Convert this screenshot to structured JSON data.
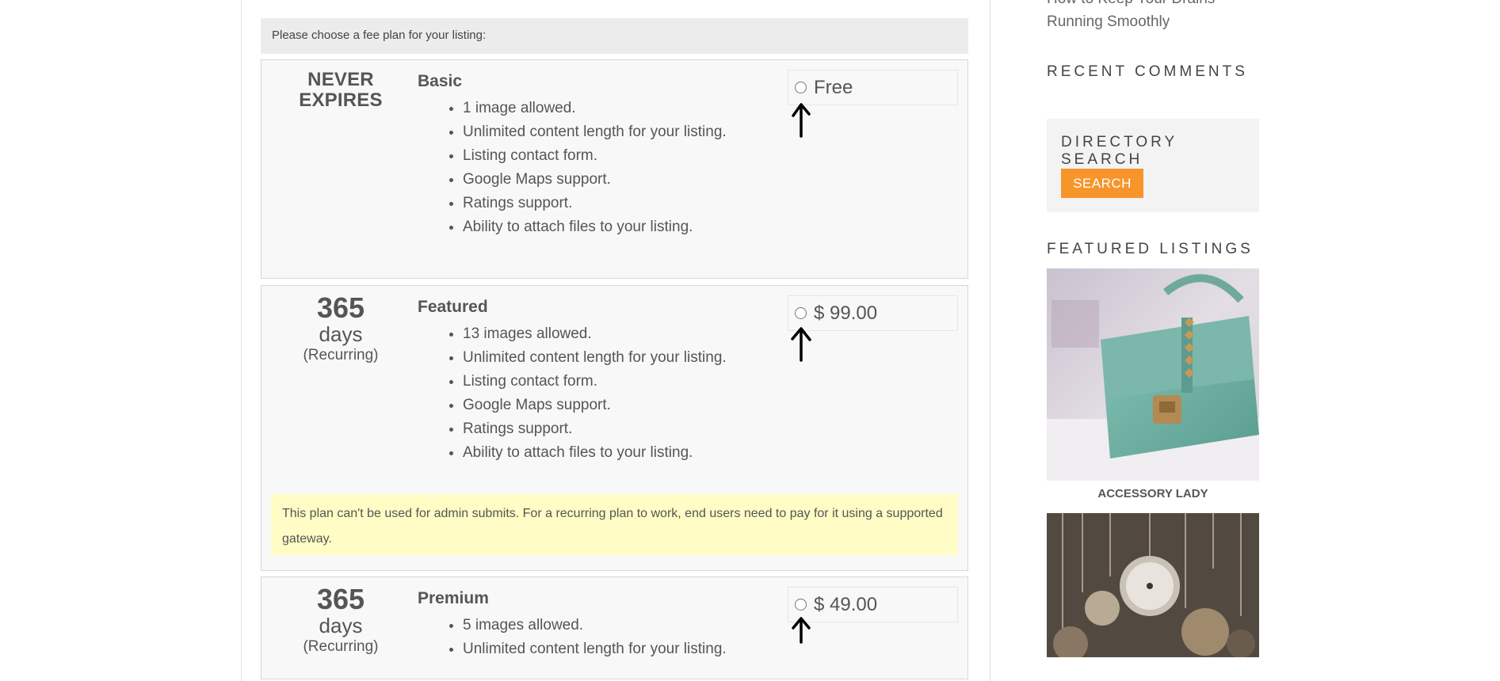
{
  "notice": {
    "text": "Please choose a fee plan for your listing:"
  },
  "plans": [
    {
      "duration_top": "NEVER",
      "duration_bottom": "EXPIRES",
      "name": "Basic",
      "price": "Free",
      "features": [
        "1 image allowed.",
        "Unlimited content length for your listing.",
        "Listing contact form.",
        "Google Maps support.",
        "Ratings support.",
        "Ability to attach files to your listing."
      ]
    },
    {
      "duration_num": "365",
      "duration_unit": "days",
      "duration_note": "(Recurring)",
      "name": "Featured",
      "price": "$ 99.00",
      "features": [
        "13 images allowed.",
        "Unlimited content length for your listing.",
        "Listing contact form.",
        "Google Maps support.",
        "Ratings support.",
        "Ability to attach files to your listing."
      ],
      "warning": "This plan can't be used for admin submits. For a recurring plan to work, end users need to pay for it using a supported gateway."
    },
    {
      "duration_num": "365",
      "duration_unit": "days",
      "duration_note": "(Recurring)",
      "name": "Premium",
      "price": "$ 49.00",
      "features": [
        "5 images allowed.",
        "Unlimited content length for your listing."
      ]
    }
  ],
  "sidebar": {
    "recent_post_line1": "How to Keep Your Drains",
    "recent_post_line2": "Running Smoothly",
    "recent_comments_heading": "RECENT COMMENTS",
    "directory_search_heading": "DIRECTORY SEARCH",
    "search_button": "SEARCH",
    "featured_heading": "FEATURED LISTINGS",
    "featured_listings": [
      {
        "name": "ACCESSORY LADY"
      }
    ]
  }
}
